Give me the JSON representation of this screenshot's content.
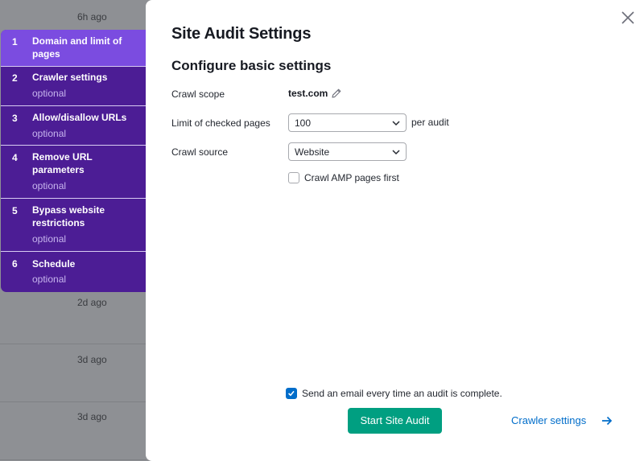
{
  "background": {
    "times": [
      "6h ago",
      "2d ago",
      "3d ago",
      "3d ago"
    ]
  },
  "stepper": {
    "steps": [
      {
        "num": "1",
        "title": "Domain and limit of pages",
        "sub": ""
      },
      {
        "num": "2",
        "title": "Crawler settings",
        "sub": "optional"
      },
      {
        "num": "3",
        "title": "Allow/disallow URLs",
        "sub": "optional"
      },
      {
        "num": "4",
        "title": "Remove URL parameters",
        "sub": "optional"
      },
      {
        "num": "5",
        "title": "Bypass website restrictions",
        "sub": "optional"
      },
      {
        "num": "6",
        "title": "Schedule",
        "sub": "optional"
      }
    ],
    "active_step": 1
  },
  "modal": {
    "title": "Site Audit Settings",
    "section_title": "Configure basic settings",
    "crawl_scope": {
      "label": "Crawl scope",
      "value": "test.com",
      "edit_icon": "pencil-icon"
    },
    "limit": {
      "label": "Limit of checked pages",
      "value": "100",
      "suffix": "per audit"
    },
    "source": {
      "label": "Crawl source",
      "value": "Website"
    },
    "amp": {
      "label": "Crawl AMP pages first",
      "checked": false
    },
    "email": {
      "label": "Send an email every time an audit is complete.",
      "checked": true
    },
    "start_button": "Start Site Audit",
    "crawler_link": "Crawler settings",
    "close_icon": "close-icon"
  },
  "colors": {
    "stepper_bg": "#4c1d95",
    "stepper_active": "#7b4ce0",
    "primary_button": "#009f81",
    "link": "#006dca"
  }
}
